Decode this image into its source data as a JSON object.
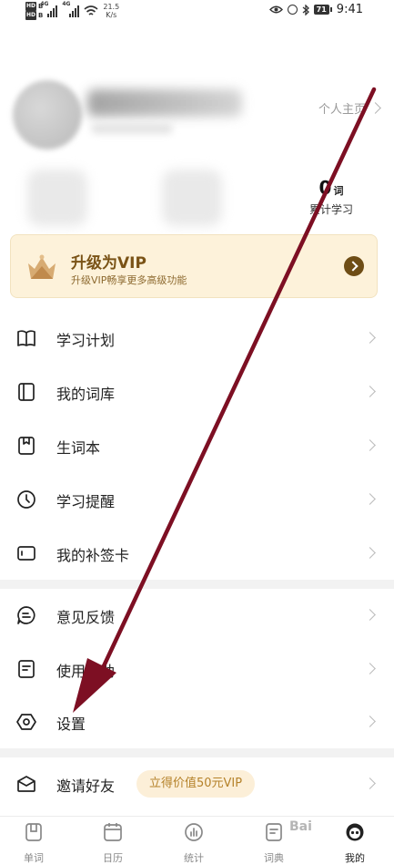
{
  "status_bar": {
    "net_speed": "21.5",
    "net_unit": "K/s",
    "network_a": "4G",
    "network_b": "4G",
    "battery": "71",
    "time": "9:41"
  },
  "profile": {
    "homepage_label": "个人主页",
    "word_count": "0",
    "word_unit": "词",
    "word_label": "累计学习"
  },
  "vip": {
    "title": "升级为VIP",
    "subtitle": "升级VIP畅享更多高级功能"
  },
  "menu": {
    "group1": [
      {
        "label": "学习计划",
        "icon": "book-open-icon"
      },
      {
        "label": "我的词库",
        "icon": "word-library-icon"
      },
      {
        "label": "生词本",
        "icon": "bookmark-book-icon"
      },
      {
        "label": "学习提醒",
        "icon": "clock-icon"
      },
      {
        "label": "我的补签卡",
        "icon": "card-icon"
      }
    ],
    "group2": [
      {
        "label": "意见反馈",
        "icon": "feedback-chat-icon"
      },
      {
        "label": "使用帮助",
        "icon": "help-document-icon"
      },
      {
        "label": "设置",
        "icon": "settings-hexagon-icon"
      }
    ],
    "invite": {
      "label": "邀请好友",
      "badge": "立得价值50元VIP",
      "icon": "envelope-icon"
    }
  },
  "tabs": [
    {
      "label": "单词",
      "icon": "word-card-icon"
    },
    {
      "label": "日历",
      "icon": "calendar-icon"
    },
    {
      "label": "统计",
      "icon": "stats-icon"
    },
    {
      "label": "词典",
      "icon": "dictionary-icon"
    },
    {
      "label": "我的",
      "icon": "profile-avatar-icon",
      "active": true
    }
  ],
  "colors": {
    "vip_bg": "#fdf2da",
    "vip_text": "#7a5316",
    "annotation_arrow": "#7d0f23"
  }
}
